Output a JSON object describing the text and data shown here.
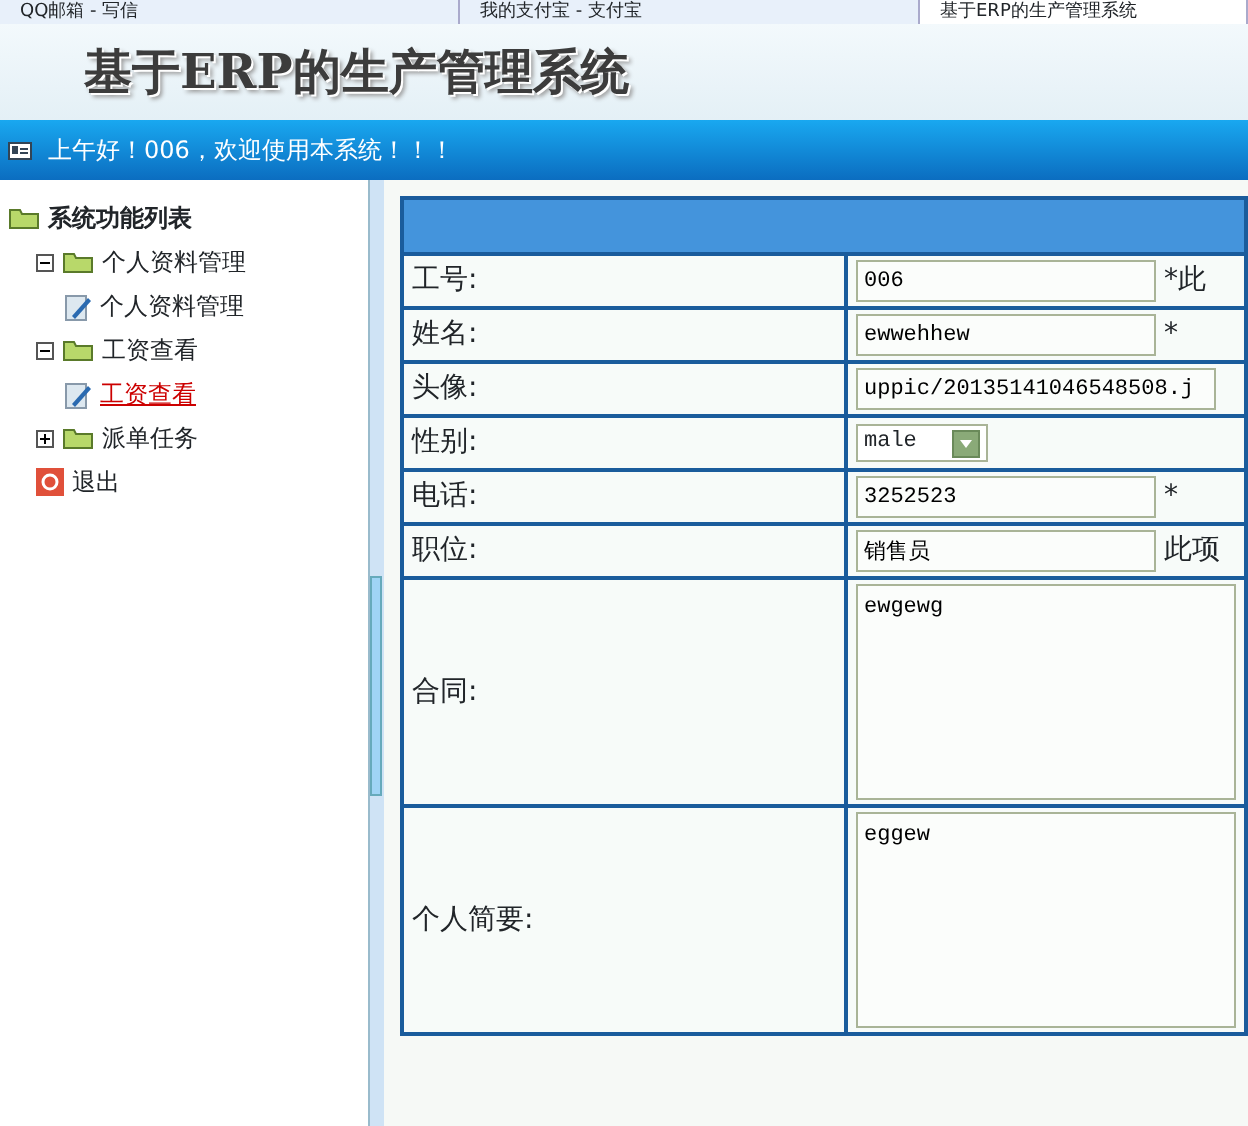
{
  "browser_tabs": [
    {
      "title": "QQ邮箱 - 写信",
      "selected": false
    },
    {
      "title": "我的支付宝 - 支付宝",
      "selected": false
    },
    {
      "title": "基于ERP的生产管理系统",
      "selected": true
    }
  ],
  "header": {
    "title": "基于ERP的生产管理系统",
    "greeting": "上午好！006，欢迎使用本系统！！！"
  },
  "sidebar": {
    "tree": [
      {
        "label": "系统功能列表",
        "kind": "root",
        "children": [
          {
            "label": "个人资料管理",
            "kind": "folder",
            "expanded": true,
            "children": [
              {
                "label": "个人资料管理",
                "kind": "page",
                "selected": false
              }
            ]
          },
          {
            "label": "工资查看",
            "kind": "folder",
            "expanded": true,
            "children": [
              {
                "label": "工资查看",
                "kind": "page",
                "selected": true
              }
            ]
          },
          {
            "label": "派单任务",
            "kind": "folder",
            "expanded": false
          },
          {
            "label": "退出",
            "kind": "exit",
            "selected": false
          }
        ]
      }
    ]
  },
  "form": {
    "rows": [
      {
        "label": "工号:",
        "kind": "text",
        "value": "006",
        "note": "*此"
      },
      {
        "label": "姓名:",
        "kind": "text",
        "value": "ewwehhew",
        "note": "*"
      },
      {
        "label": "头像:",
        "kind": "wide",
        "value": "uppic/20135141046548508.j"
      },
      {
        "label": "性别:",
        "kind": "select",
        "value": "male"
      },
      {
        "label": "电话:",
        "kind": "text",
        "value": "3252523",
        "note": "*"
      },
      {
        "label": "职位:",
        "kind": "text",
        "value": "销售员",
        "note": "此项"
      },
      {
        "label": "合同:",
        "kind": "textarea",
        "value": "ewgewg"
      },
      {
        "label": "个人简要:",
        "kind": "textarea",
        "value": "eggew"
      }
    ]
  }
}
